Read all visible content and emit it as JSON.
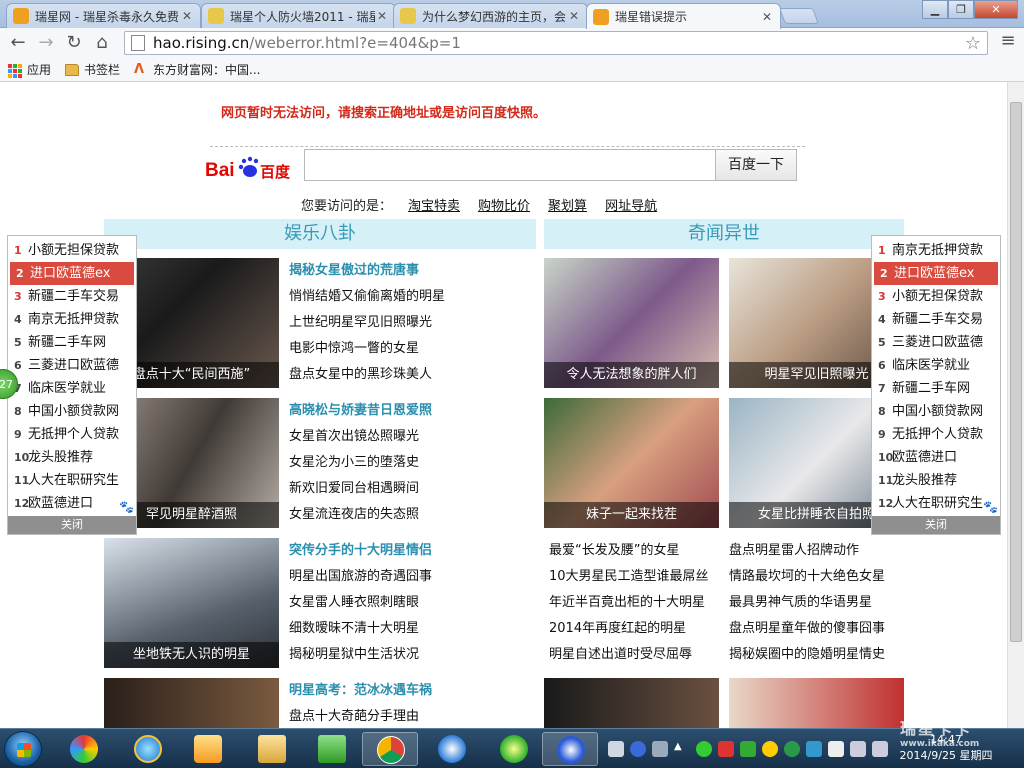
{
  "browser": {
    "tabs": [
      {
        "title": "瑞星网 - 瑞星杀毒永久免费",
        "active": false
      },
      {
        "title": "瑞星个人防火墙2011 - 瑞星",
        "active": false
      },
      {
        "title": "为什么梦幻西游的主页，会...",
        "active": false
      },
      {
        "title": "瑞星错误提示",
        "active": true
      }
    ],
    "url_host": "hao.rising.cn",
    "url_path": "/weberror.html?e=404&p=1",
    "bookmarks": [
      "应用",
      "书签栏",
      "东方财富网：中国..."
    ]
  },
  "page": {
    "error_message": "网页暂时无法访问，请搜索正确地址或是访问百度快照。",
    "search_button": "百度一下",
    "logo_text": "Bai",
    "logo_cn": "百度",
    "quicklinks_prefix": "您要访问的是：",
    "quicklinks": [
      "淘宝特卖",
      "购物比价",
      "聚划算",
      "网址导航"
    ],
    "sections": [
      {
        "title": "娱乐八卦"
      },
      {
        "title": "奇闻异世"
      }
    ],
    "ent_thumbs": [
      "盘点十大“民间西施”",
      "罕见明星醉酒照",
      "坐地铁无人识的明星",
      ""
    ],
    "ent_lists": [
      [
        "揭秘女星傲过的荒唐事",
        "悄悄结婚又偷偷离婚的明星",
        "上世纪明星罕见旧照曝光",
        "电影中惊鸿一瞥的女星",
        "盘点女星中的黑珍珠美人"
      ],
      [
        "高晓松与娇妻昔日恩爱照",
        "女星首次出镜怂照曝光",
        "女星沦为小三的堕落史",
        "新欢旧爱同台相遇瞬间",
        "女星流连夜店的失态照"
      ],
      [
        "突传分手的十大明星情侣",
        "明星出国旅游的奇遇囧事",
        "女星雷人睡衣照刺瞎眼",
        "细数暧昧不清十大明星",
        "揭秘明星狱中生活状况"
      ],
      [
        "明星高考：范冰冰遇车祸",
        "盘点十大奇葩分手理由"
      ]
    ],
    "odd_thumbs": [
      "令人无法想象的胖人们",
      "明星罕见旧照曝光",
      "妹子一起来找茬",
      "女星比拼睡衣自拍照"
    ],
    "odd_list_left": [
      "最爱“长发及腰”的女星",
      "10大男星民工造型谁最屌丝",
      "年近半百竟出柜的十大明星",
      "2014年再度红起的明星",
      "明星自述出道时受尽屈辱"
    ],
    "odd_list_right": [
      "盘点明星雷人招牌动作",
      "情路最坎坷的十大绝色女星",
      "最具男神气质的华语男星",
      "盘点明星童年做的傻事囧事",
      "揭秘娱圈中的隐婚明星情史"
    ]
  },
  "rank_left": {
    "items": [
      "小额无担保贷款",
      "进口欧蓝德ex",
      "新疆二手车交易",
      "南京无抵押贷款",
      "新疆二手车网",
      "三菱进口欧蓝德",
      "临床医学就业",
      "中国小额贷款网",
      "无抵押个人贷款",
      "龙头股推荐",
      "人大在职研究生",
      "欧蓝德进口"
    ],
    "close": "关闭",
    "badge": "27"
  },
  "rank_right": {
    "items": [
      "南京无抵押贷款",
      "进口欧蓝德ex",
      "小额无担保贷款",
      "新疆二手车交易",
      "三菱进口欧蓝德",
      "临床医学就业",
      "新疆二手车网",
      "中国小额贷款网",
      "无抵押个人贷款",
      "欧蓝德进口",
      "龙头股推荐",
      "人大在职研究生"
    ],
    "close": "关闭"
  },
  "taskbar": {
    "time": "14:47",
    "date": "2014/9/25 星期四",
    "watermark": "瑞星卡卡",
    "watermark_url": "www.ikaka.com"
  },
  "colors": {
    "accent_red": "#d32a1a",
    "section_text": "#3a9bb8",
    "section_bg": "#d6f0f8",
    "rank_selected": "#d94b3e"
  }
}
